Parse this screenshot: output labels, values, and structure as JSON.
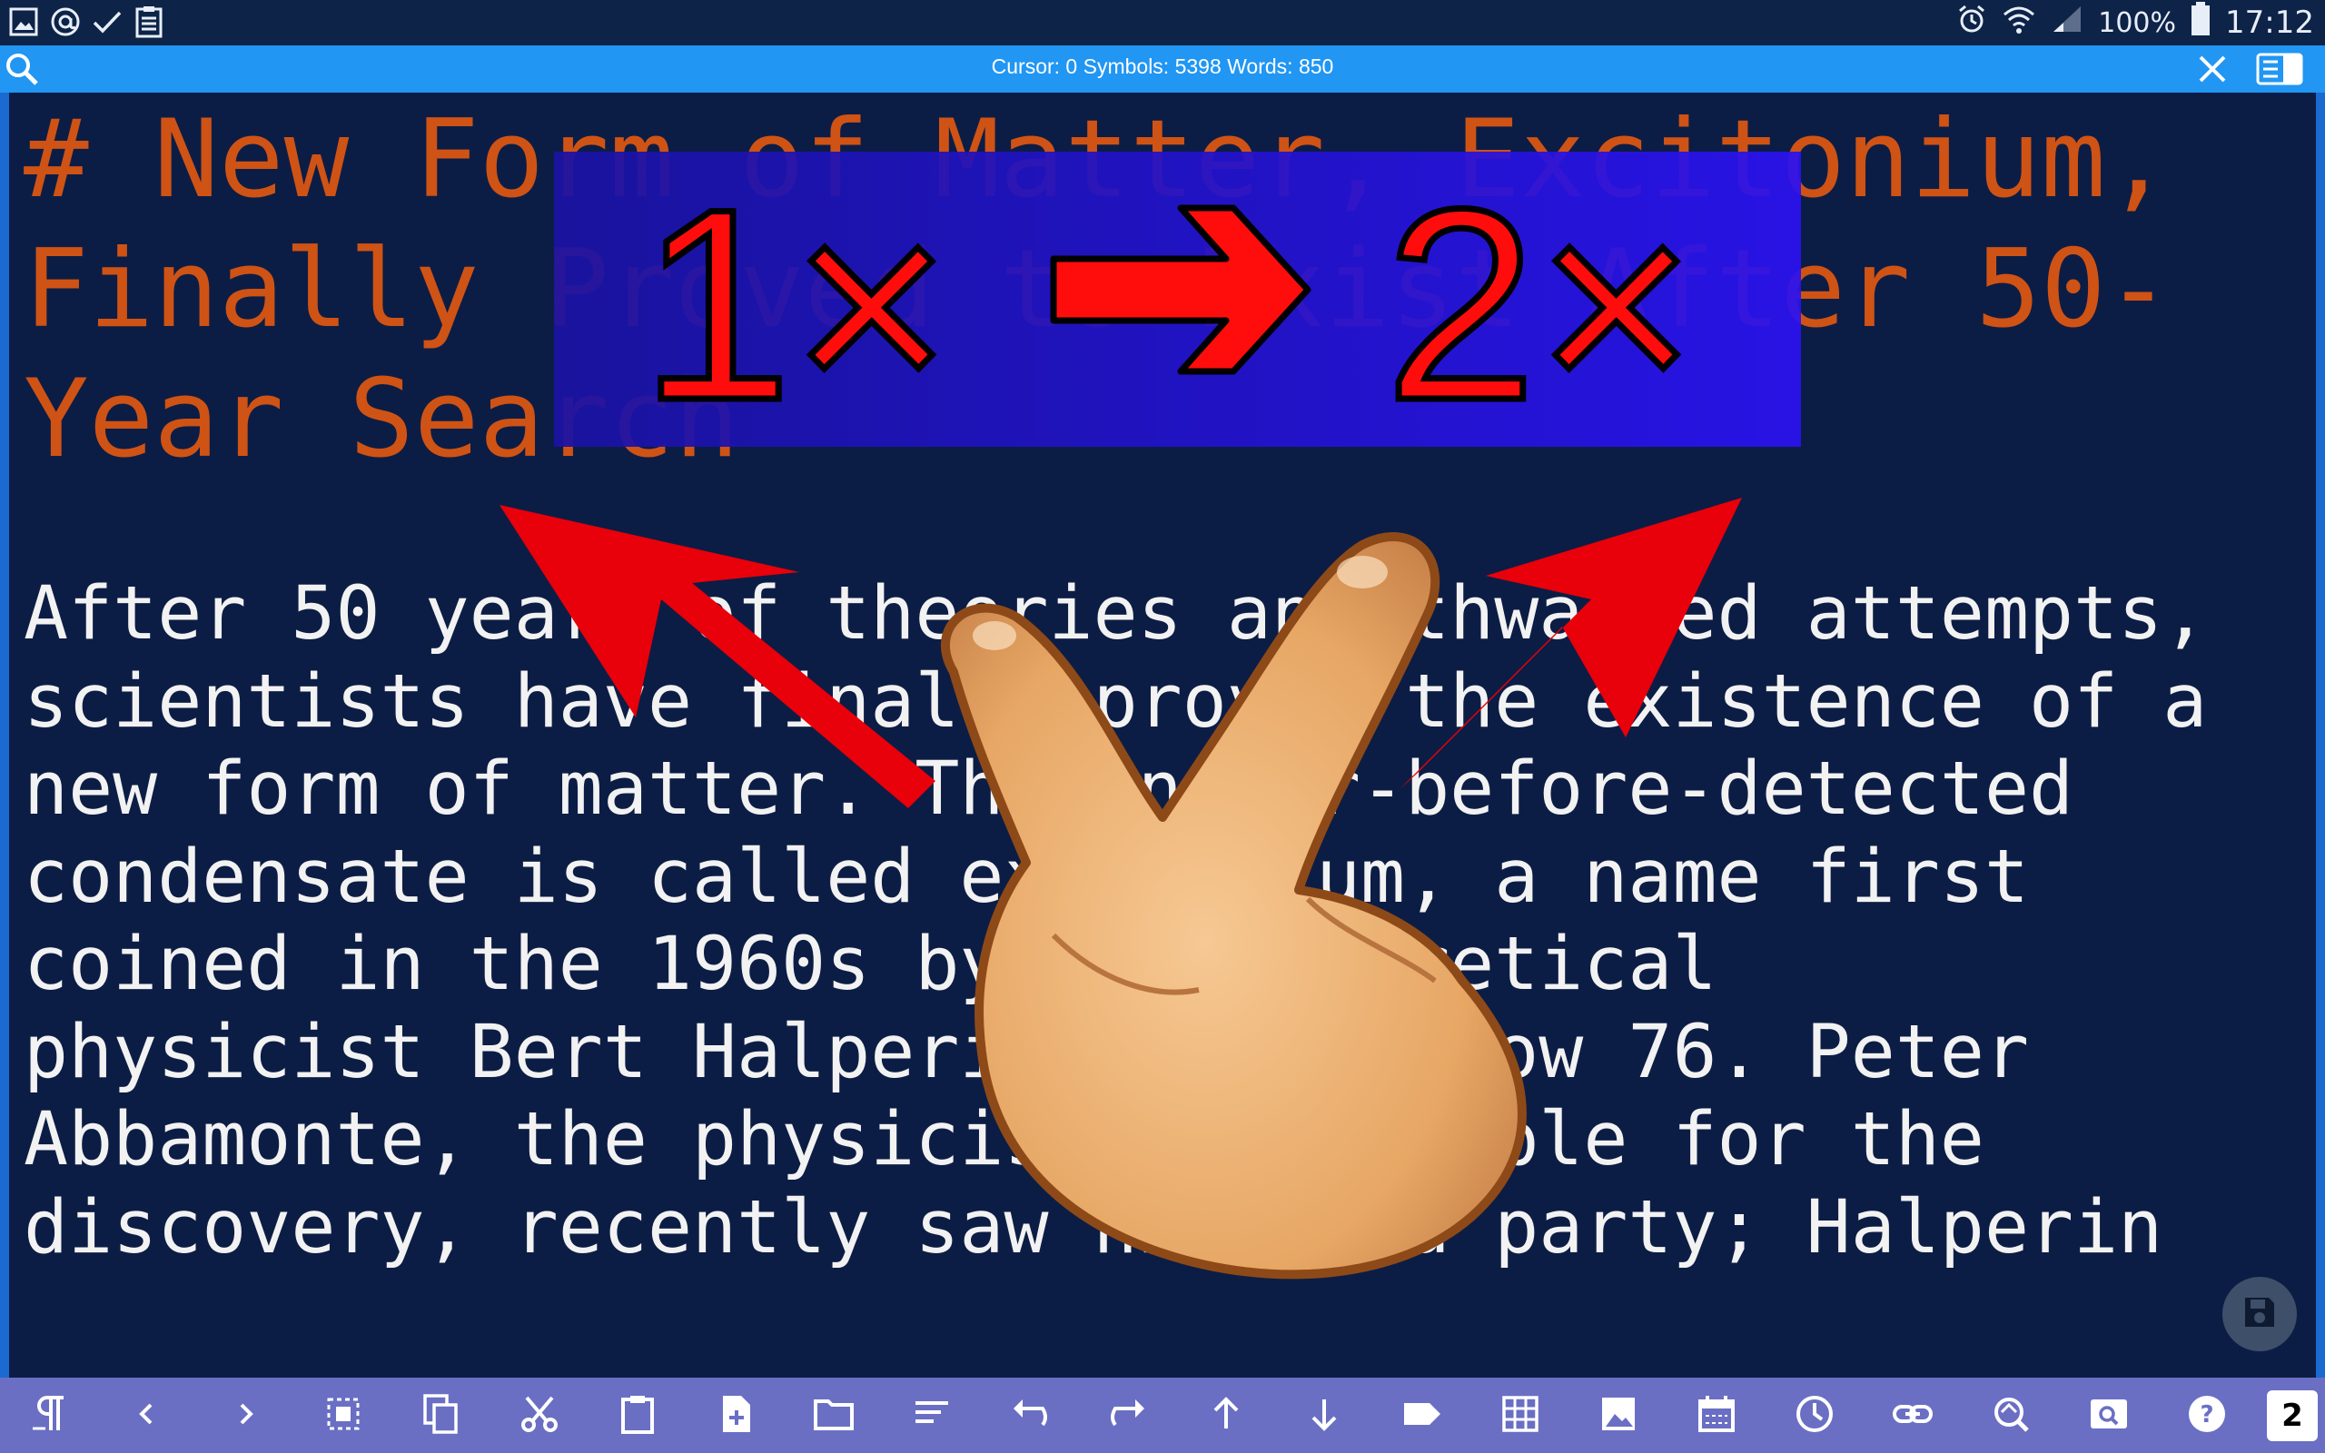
{
  "status_bar": {
    "battery_text": "100%",
    "time": "17:12",
    "left_icons": [
      "gallery-icon",
      "at-sign-icon",
      "check-icon",
      "clipboard-icon"
    ],
    "right_icons": [
      "alarm-icon",
      "wifi-icon",
      "signal-icon",
      "battery-icon"
    ]
  },
  "info_bar": {
    "text": "Cursor: 0 Symbols: 5398 Words: 850"
  },
  "editor": {
    "heading": "# New Form of Matter, Excitonium,\nFinally Proved to Exist After 50-\nYear Search",
    "body": "After 50 years of theories and thwarted attempts,\nscientists have finally proved the existence of a\nnew form of matter. This never-before-detected\ncondensate is called excitonium, a name first\ncoined in the 1960s by the theoretical\nphysicist Bert Halperin, who is now 76. Peter\nAbbamonte, the physicist responsible for the\ndiscovery, recently saw him at a party; Halperin"
  },
  "overlay": {
    "zoom_from": "1×",
    "zoom_to": "2×",
    "gesture": "pinch-zoom-hand"
  },
  "toolbar": {
    "items": [
      "paragraph-icon",
      "prev-icon",
      "next-icon",
      "select-all-icon",
      "copy-icon",
      "cut-icon",
      "paste-icon",
      "new-file-icon",
      "open-folder-icon",
      "format-icon",
      "undo-icon",
      "redo-icon",
      "scroll-up-icon",
      "scroll-down-icon",
      "tag-icon",
      "table-icon",
      "image-icon",
      "calendar-icon",
      "clock-icon",
      "link-icon",
      "search-replace-icon",
      "preview-icon",
      "help-icon"
    ],
    "counter": "2"
  },
  "colors": {
    "heading": "#cf5315",
    "body_text": "#f2f2f2",
    "background": "#0c1d45",
    "info_bar": "#2196f3",
    "toolbar": "#6a6fc4"
  }
}
